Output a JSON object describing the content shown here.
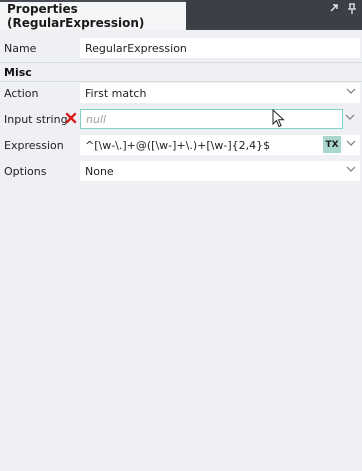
{
  "title": "Properties (RegularExpression)",
  "title_icons": {
    "pin": "pin-icon",
    "float": "float-icon"
  },
  "rows": {
    "name": {
      "label": "Name",
      "value": "RegularExpression"
    },
    "category_misc": "Misc",
    "action": {
      "label": "Action",
      "value": "First match"
    },
    "input_string": {
      "label": "Input string",
      "placeholder": "null"
    },
    "expression": {
      "label": "Expression",
      "value": "^[\\w-\\.]+@([\\w-]+\\.)+[\\w-]{2,4}$",
      "badge": "TX"
    },
    "options": {
      "label": "Options",
      "value": "None"
    }
  },
  "colors": {
    "titlebar": "#3c3f45",
    "panel": "#eef0f3",
    "focus_border": "#7dd3c5",
    "error": "#d91a1a",
    "badge": "#a9d6cd"
  }
}
